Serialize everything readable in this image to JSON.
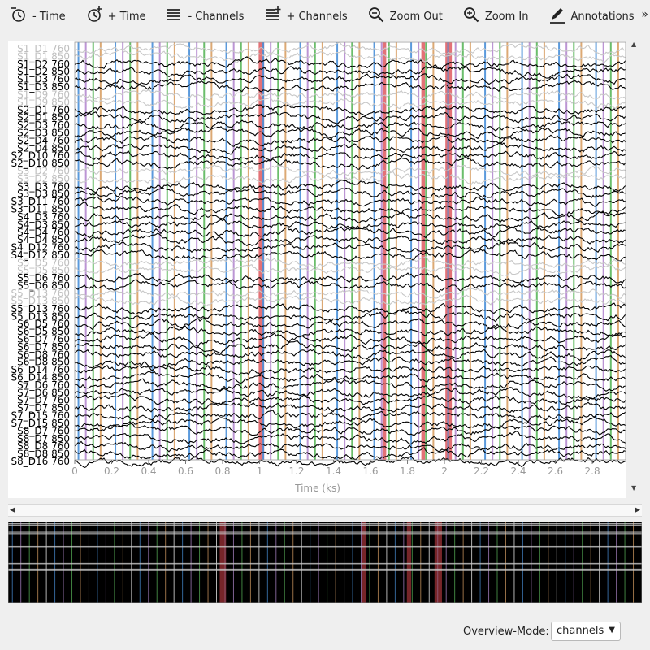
{
  "toolbar": {
    "items": [
      {
        "label": "- Time",
        "icon": "clock-minus-icon"
      },
      {
        "label": "+ Time",
        "icon": "clock-plus-icon"
      },
      {
        "label": "- Channels",
        "icon": "channels-minus-icon"
      },
      {
        "label": "+ Channels",
        "icon": "channels-plus-icon"
      },
      {
        "label": "Zoom Out",
        "icon": "zoom-out-icon"
      },
      {
        "label": "Zoom In",
        "icon": "zoom-in-icon"
      },
      {
        "label": "Annotations",
        "icon": "pencil-icon"
      }
    ],
    "more": "»"
  },
  "plot": {
    "channels": [
      {
        "label": "S1_D1 760",
        "bad": true
      },
      {
        "label": "S1_D1 850",
        "bad": true
      },
      {
        "label": "S1_D2 760",
        "bad": false
      },
      {
        "label": "S1_D2 850",
        "bad": false
      },
      {
        "label": "S1_D3 760",
        "bad": false
      },
      {
        "label": "S1_D3 850",
        "bad": false
      },
      {
        "label": "S1_D9 760",
        "bad": true
      },
      {
        "label": "S1_D9 850",
        "bad": true
      },
      {
        "label": "S2_D1 760",
        "bad": false
      },
      {
        "label": "S2_D1 850",
        "bad": false
      },
      {
        "label": "S2_D3 760",
        "bad": false
      },
      {
        "label": "S2_D3 850",
        "bad": false
      },
      {
        "label": "S2_D4 760",
        "bad": false
      },
      {
        "label": "S2_D4 850",
        "bad": false
      },
      {
        "label": "S2_D10 760",
        "bad": false
      },
      {
        "label": "S2_D10 850",
        "bad": false
      },
      {
        "label": "S3_D2 760",
        "bad": true
      },
      {
        "label": "S3_D2 850",
        "bad": true
      },
      {
        "label": "S3_D3 760",
        "bad": false
      },
      {
        "label": "S3_D3 850",
        "bad": false
      },
      {
        "label": "S3_D11 760",
        "bad": false
      },
      {
        "label": "S3_D11 850",
        "bad": false
      },
      {
        "label": "S4_D3 760",
        "bad": false
      },
      {
        "label": "S4_D3 850",
        "bad": false
      },
      {
        "label": "S4_D4 760",
        "bad": false
      },
      {
        "label": "S4_D4 850",
        "bad": false
      },
      {
        "label": "S4_D12 760",
        "bad": false
      },
      {
        "label": "S4_D12 850",
        "bad": false
      },
      {
        "label": "S5_D5 760",
        "bad": true
      },
      {
        "label": "S5_D5 850",
        "bad": true
      },
      {
        "label": "S5_D6 760",
        "bad": false
      },
      {
        "label": "S5_D6 850",
        "bad": false
      },
      {
        "label": "S5_D13 760",
        "bad": true
      },
      {
        "label": "S5_D13 850",
        "bad": true
      },
      {
        "label": "S5_D13 760",
        "bad": false
      },
      {
        "label": "S5_D13 850",
        "bad": false
      },
      {
        "label": "S6_D5 760",
        "bad": false
      },
      {
        "label": "S6_D5 850",
        "bad": false
      },
      {
        "label": "S6_D7 760",
        "bad": false
      },
      {
        "label": "S6_D7 850",
        "bad": false
      },
      {
        "label": "S6_D8 760",
        "bad": false
      },
      {
        "label": "S6_D8 850",
        "bad": false
      },
      {
        "label": "S6_D14 760",
        "bad": false
      },
      {
        "label": "S6_D14 850",
        "bad": false
      },
      {
        "label": "S7_D6 760",
        "bad": false
      },
      {
        "label": "S7_D6 850",
        "bad": false
      },
      {
        "label": "S7_D7 760",
        "bad": false
      },
      {
        "label": "S7_D7 850",
        "bad": false
      },
      {
        "label": "S7_D15 760",
        "bad": false
      },
      {
        "label": "S7_D15 850",
        "bad": false
      },
      {
        "label": "S8_D7 760",
        "bad": false
      },
      {
        "label": "S8_D7 850",
        "bad": false
      },
      {
        "label": "S8_D8 760",
        "bad": false
      },
      {
        "label": "S8_D8 850",
        "bad": false
      },
      {
        "label": "S8_D16 760",
        "bad": false
      }
    ],
    "x_ticks": [
      "0",
      "0.2",
      "0.4",
      "0.6",
      "0.8",
      "1",
      "1.2",
      "1.4",
      "1.6",
      "1.8",
      "2",
      "2.2",
      "2.4",
      "2.6",
      "2.8"
    ],
    "x_label": "Time (ks)",
    "x_range_ks": [
      0,
      2.98
    ],
    "event_times_ks": [
      0.02,
      0.06,
      0.1,
      0.14,
      0.18,
      0.22,
      0.26,
      0.3,
      0.34,
      0.38,
      0.42,
      0.46,
      0.5,
      0.54,
      0.58,
      0.62,
      0.66,
      0.7,
      0.74,
      0.78,
      0.82,
      0.86,
      0.9,
      0.94,
      0.98,
      1.02,
      1.06,
      1.1,
      1.14,
      1.18,
      1.22,
      1.26,
      1.3,
      1.34,
      1.38,
      1.42,
      1.46,
      1.5,
      1.54,
      1.58,
      1.62,
      1.66,
      1.7,
      1.74,
      1.78,
      1.82,
      1.86,
      1.9,
      1.94,
      1.98,
      2.02,
      2.06,
      2.1,
      2.14,
      2.18,
      2.22,
      2.26,
      2.3,
      2.34,
      2.38,
      2.42,
      2.46,
      2.5,
      2.54,
      2.58,
      2.62,
      2.66,
      2.7,
      2.74,
      2.78,
      2.82,
      2.86,
      2.9,
      2.94
    ],
    "event_colors": [
      "#4a90d9",
      "#b58ad0",
      "#5cb85c",
      "#d9a066",
      "#ffffff"
    ],
    "bad_segments_ks": [
      [
        0.995,
        1.025
      ],
      [
        1.665,
        1.685
      ],
      [
        1.875,
        1.895
      ],
      [
        2.005,
        2.04
      ]
    ],
    "bad_color": "#d9434a",
    "trace_color": "#000000",
    "bad_trace_color": "#c8c8c8"
  },
  "overview": {
    "mode_label": "Overview-Mode:",
    "mode_value": "channels"
  }
}
